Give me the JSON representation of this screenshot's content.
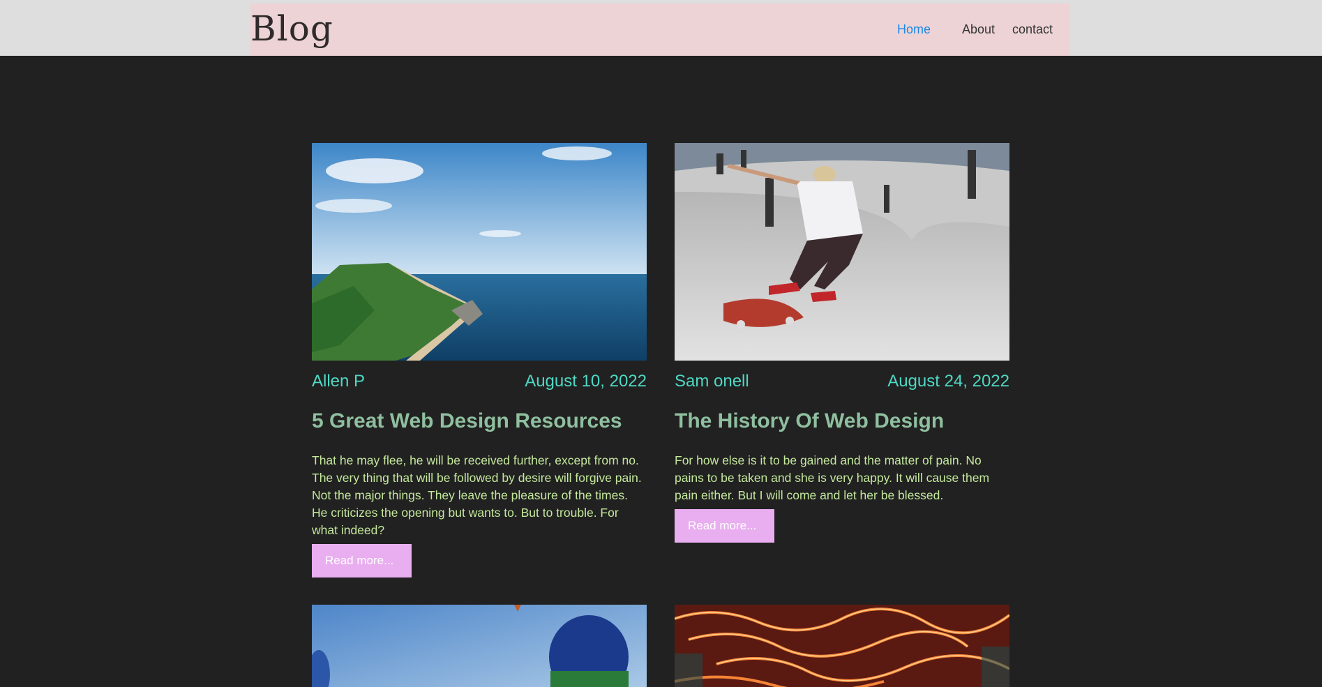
{
  "site": {
    "logo": "Blog"
  },
  "nav": [
    {
      "label": "Home",
      "active": true
    },
    {
      "label": "About",
      "active": false
    },
    {
      "label": "contact",
      "active": false
    }
  ],
  "posts": [
    {
      "author": "Allen P",
      "date": "August 10, 2022",
      "title": "5 Great Web Design Resources",
      "excerpt": "That he may flee, he will be received further, except from no. The very thing that will be followed by desire will forgive pain. Not the major things. They leave the pleasure of the times. He criticizes the opening but wants to. But to trouble. For what indeed?",
      "read_more": "Read more...",
      "image": "coastal-cliffs-photo"
    },
    {
      "author": "Sam onell",
      "date": "August 24, 2022",
      "title": "The History Of Web Design",
      "excerpt": "For how else is it to be gained and the matter of pain. No pains to be taken and she is very happy. It will cause them pain either. But I will come and let her be blessed.",
      "read_more": "Read more...",
      "image": "skateboarder-photo"
    },
    {
      "image": "hot-air-balloons-photo"
    },
    {
      "image": "neon-lights-photo"
    }
  ],
  "colors": {
    "page_bg": "#212121",
    "header_bg": "#edd3d6",
    "nav_active": "#1e88e5",
    "meta": "#4fd8c4",
    "title": "#8fbf9f",
    "excerpt": "#c4e89c",
    "button_bg": "#e9aef0"
  }
}
